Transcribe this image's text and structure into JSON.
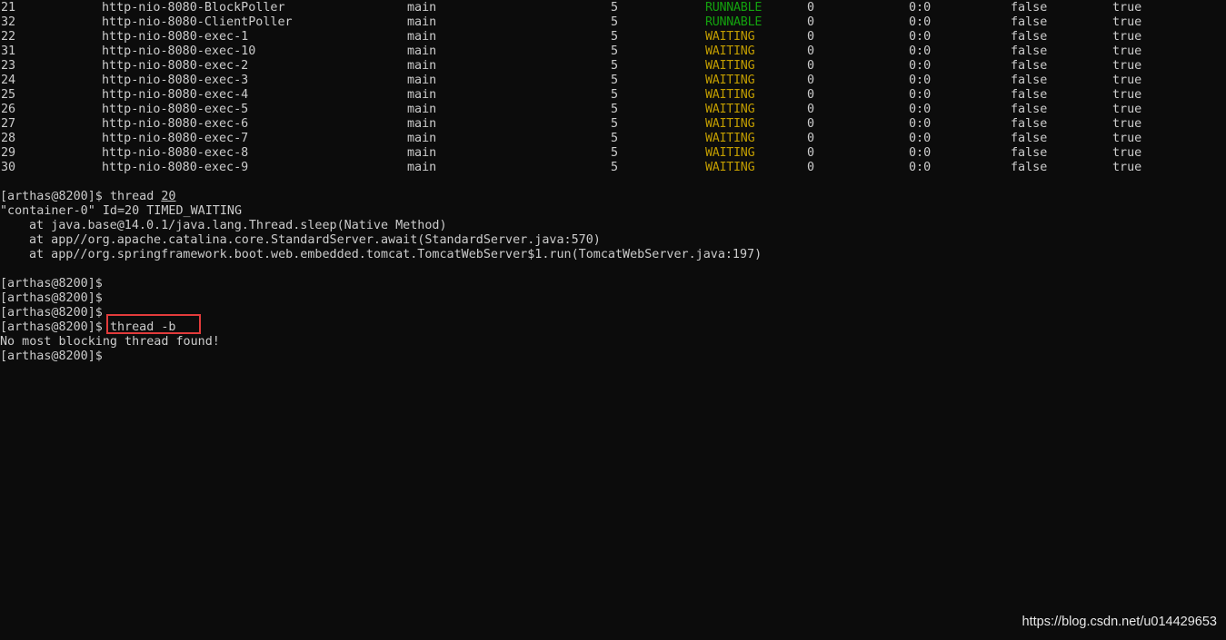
{
  "threads": [
    {
      "id": "21",
      "name": "http-nio-8080-BlockPoller",
      "group": "main",
      "priority": "5",
      "state": "RUNNABLE",
      "cpu": "0",
      "time": "0:0",
      "interrupted": "false",
      "daemon": "true"
    },
    {
      "id": "32",
      "name": "http-nio-8080-ClientPoller",
      "group": "main",
      "priority": "5",
      "state": "RUNNABLE",
      "cpu": "0",
      "time": "0:0",
      "interrupted": "false",
      "daemon": "true"
    },
    {
      "id": "22",
      "name": "http-nio-8080-exec-1",
      "group": "main",
      "priority": "5",
      "state": "WAITING",
      "cpu": "0",
      "time": "0:0",
      "interrupted": "false",
      "daemon": "true"
    },
    {
      "id": "31",
      "name": "http-nio-8080-exec-10",
      "group": "main",
      "priority": "5",
      "state": "WAITING",
      "cpu": "0",
      "time": "0:0",
      "interrupted": "false",
      "daemon": "true"
    },
    {
      "id": "23",
      "name": "http-nio-8080-exec-2",
      "group": "main",
      "priority": "5",
      "state": "WAITING",
      "cpu": "0",
      "time": "0:0",
      "interrupted": "false",
      "daemon": "true"
    },
    {
      "id": "24",
      "name": "http-nio-8080-exec-3",
      "group": "main",
      "priority": "5",
      "state": "WAITING",
      "cpu": "0",
      "time": "0:0",
      "interrupted": "false",
      "daemon": "true"
    },
    {
      "id": "25",
      "name": "http-nio-8080-exec-4",
      "group": "main",
      "priority": "5",
      "state": "WAITING",
      "cpu": "0",
      "time": "0:0",
      "interrupted": "false",
      "daemon": "true"
    },
    {
      "id": "26",
      "name": "http-nio-8080-exec-5",
      "group": "main",
      "priority": "5",
      "state": "WAITING",
      "cpu": "0",
      "time": "0:0",
      "interrupted": "false",
      "daemon": "true"
    },
    {
      "id": "27",
      "name": "http-nio-8080-exec-6",
      "group": "main",
      "priority": "5",
      "state": "WAITING",
      "cpu": "0",
      "time": "0:0",
      "interrupted": "false",
      "daemon": "true"
    },
    {
      "id": "28",
      "name": "http-nio-8080-exec-7",
      "group": "main",
      "priority": "5",
      "state": "WAITING",
      "cpu": "0",
      "time": "0:0",
      "interrupted": "false",
      "daemon": "true"
    },
    {
      "id": "29",
      "name": "http-nio-8080-exec-8",
      "group": "main",
      "priority": "5",
      "state": "WAITING",
      "cpu": "0",
      "time": "0:0",
      "interrupted": "false",
      "daemon": "true"
    },
    {
      "id": "30",
      "name": "http-nio-8080-exec-9",
      "group": "main",
      "priority": "5",
      "state": "WAITING",
      "cpu": "0",
      "time": "0:0",
      "interrupted": "false",
      "daemon": "true"
    }
  ],
  "colors": {
    "background": "#0c0c0c",
    "text": "#cccccc",
    "runnable": "#13a10e",
    "waiting": "#c19c00",
    "highlight_box": "#e23b3b"
  },
  "session": {
    "prompt": "[arthas@8200]$",
    "thread_cmd_prefix": "thread ",
    "thread_cmd_arg": "20",
    "thread_header": "\"container-0\" Id=20 TIMED_WAITING",
    "stack": [
      "at java.base@14.0.1/java.lang.Thread.sleep(Native Method)",
      "at app//org.apache.catalina.core.StandardServer.await(StandardServer.java:570)",
      "at app//org.springframework.boot.web.embedded.tomcat.TomcatWebServer$1.run(TomcatWebServer.java:197)"
    ],
    "blocking_cmd": "thread -b",
    "blocking_result": "No most blocking thread found!"
  },
  "watermark": "https://blog.csdn.net/u014429653"
}
